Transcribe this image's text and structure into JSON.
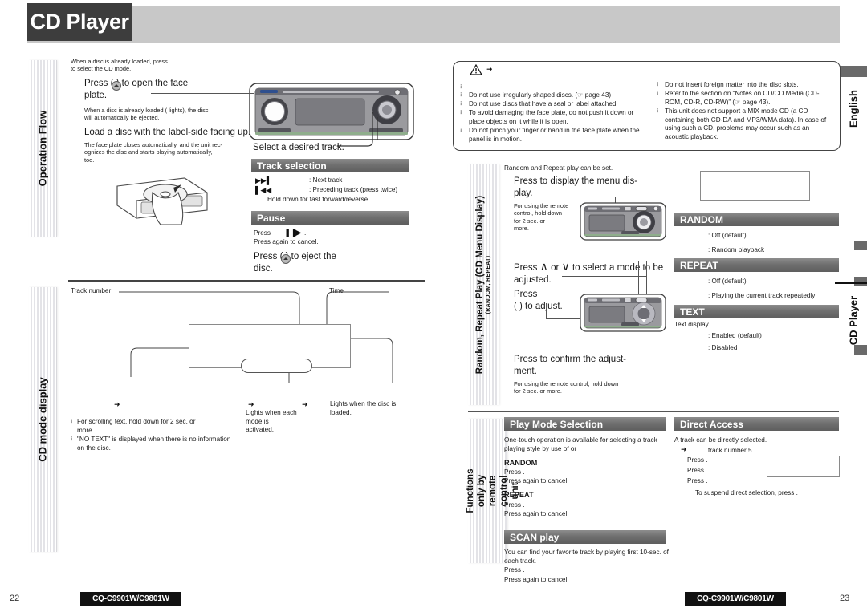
{
  "header": {
    "title": "CD Player"
  },
  "right_tabs": {
    "english": "English",
    "cd_player": "CD Player"
  },
  "left_column": {
    "tabs": [
      {
        "label": "Operation Flow",
        "sub": ""
      },
      {
        "label": "CD mode display",
        "sub": ""
      }
    ],
    "operation_flow": {
      "intro": "When a disc is already loaded, press\nto select the CD mode.",
      "step1": "Press        (            ) to open the face\nplate.",
      "step1_note_a": "When a disc is already loaded (       lights), ",
      "step1_note_b": "the disc\nwill automatically be ejected.",
      "step2": "Load a disc with the label-side facing up.",
      "step2_note": "The face plate closes automatically, and the unit rec-\nognizes the disc and starts playing automatically,\ntoo.",
      "select_track": "Select a desired  track."
    },
    "track_selection": {
      "heading": "Track selection",
      "rows": [
        {
          "icon": "next-track-icon",
          "label": ": Next track"
        },
        {
          "icon": "previous-track-icon",
          "label": ": Preceding track (press twice)"
        }
      ],
      "note": "Hold down for fast forward/reverse."
    },
    "pause": {
      "heading": "Pause",
      "line1_pre": "Press",
      "line1_glyphs": "pause-icon play-icon",
      "line1_post": ".",
      "line2": "Press again to cancel.",
      "line3": "Press        (                 ) to eject the\ndisc."
    },
    "cd_mode_display": {
      "label_track_number": "Track number",
      "label_time": "Time",
      "label_modes": "Lights when each mode is\nactivated.",
      "label_loaded": "Lights when the disc is\nloaded.",
      "notes": [
        "For scrolling text, hold down               for 2 sec. or\nmore.",
        "\"NO TEXT\" is displayed when there is no information\non the disc."
      ]
    }
  },
  "caution": {
    "title_icon": "warning-triangle-icon",
    "left_items": [
      "Do not use irregularly shaped discs. (☞  page 43)",
      "Do not use discs that have a seal or label attached.",
      "To avoid damaging the face plate, do not push it down or place objects on it while it is open.",
      "Do not pinch your finger or hand in the face plate when the panel is in motion."
    ],
    "right_items": [
      "Do not insert foreign matter into the disc slots.",
      "Refer to the section on “Notes on CD/CD Media (CD-ROM, CD-R, CD-RW)” (☞  page 43).",
      "This unit does not support a MIX mode CD (a CD containing both CD-DA and MP3/WMA data). In case of using such a CD, problems may occur such as an acoustic playback."
    ]
  },
  "middle_column": {
    "tabs": [
      {
        "label": "Random, Repeat Play (CD Menu Display)",
        "sub": "(RANDOM, REPEAT)"
      },
      {
        "label": "Functions only by\nremote control unit",
        "sub": ""
      }
    ],
    "random_repeat": {
      "intro": "Random and Repeat play can be set.",
      "step1": "Press               to display the menu dis-\nplay.",
      "step1_note": "For using the remote\ncontrol, hold down\n                 for 2 sec. or\nmore.",
      "step2_pre": "Press",
      "step2_up": "∧",
      "step2_mid": "or",
      "step2_down": "∨",
      "step2_post": "to select a mode to be\nadjusted.",
      "step3": "Press\n(      ) to adjust.",
      "step4": "Press               to confirm the adjust-\nment.",
      "step4_note": "For using the remote control, hold down\nfor 2 sec. or more."
    },
    "play_mode_selection": {
      "heading": "Play Mode Selection",
      "intro": "One-touch operation is available for selecting a track\nplaying style by use of                           or",
      "random": {
        "title": "RANDOM",
        "line1": "Press                    .",
        "line2": "Press again to cancel."
      },
      "repeat": {
        "title": "REPEAT",
        "line1": "Press                    .",
        "line2": "Press again to cancel."
      }
    },
    "scan_play": {
      "heading": "SCAN play",
      "intro": "You can find your favorite track by playing first 10-sec. of\neach track.",
      "line1": "Press                 .",
      "line2": "Press again to cancel."
    }
  },
  "right_column": {
    "random": {
      "heading": "RANDOM",
      "options": [
        ": Off  (default)",
        ": Random playback"
      ]
    },
    "repeat": {
      "heading": "REPEAT",
      "options": [
        ": Off  (default)",
        ": Playing the current track repeatedly"
      ]
    },
    "text": {
      "heading": "TEXT",
      "sub": "Text display",
      "options": [
        ": Enabled  (default)",
        ": Disabled"
      ]
    },
    "direct_access": {
      "heading": "Direct Access",
      "intro": "A track can be directly selected.",
      "example": "track number 5",
      "lines": [
        "Press                      .",
        "Press      .",
        "Press           ."
      ],
      "note": "To suspend direct selection, press              ."
    }
  },
  "footer": {
    "left_page": "22",
    "right_page": "23",
    "model_left": "CQ-C9901W/C9801W",
    "model_right": "CQ-C9901W/C9801W"
  }
}
